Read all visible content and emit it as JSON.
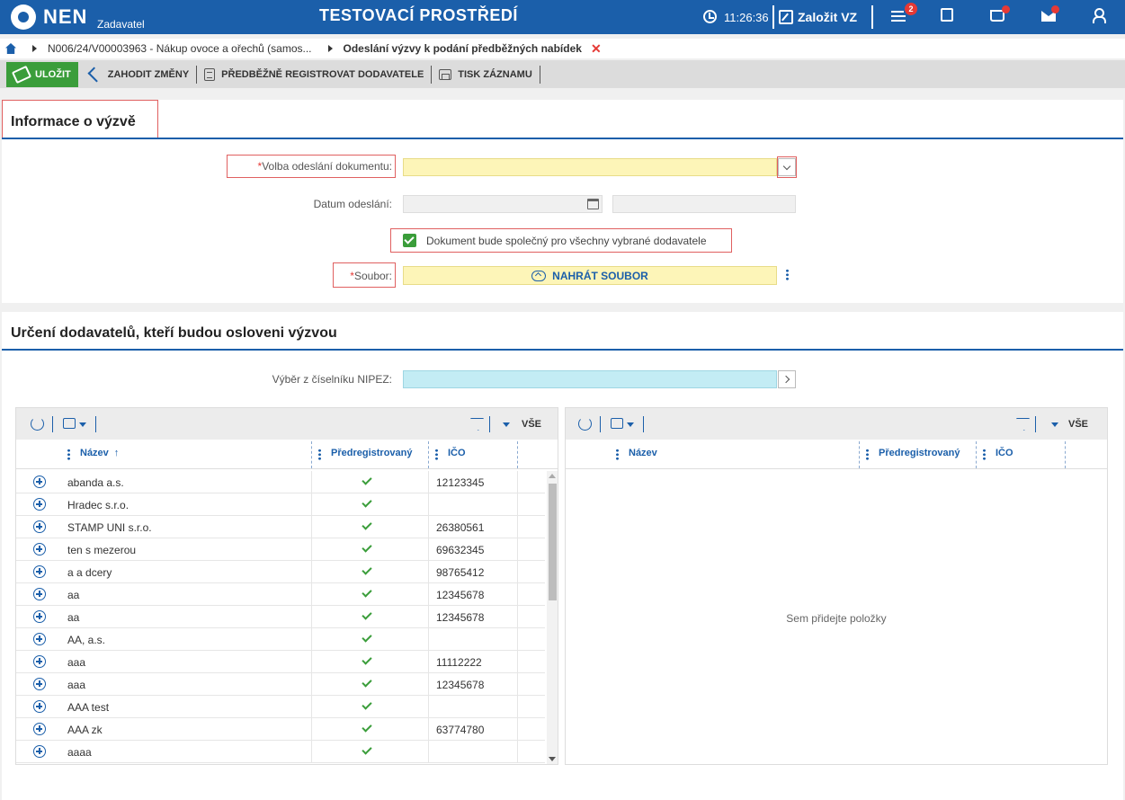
{
  "header": {
    "brand": "NEN",
    "brand_sub": "Zadavatel",
    "environment": "TESTOVACÍ PROSTŘEDÍ",
    "time": "11:26:36",
    "new_vz_label": "Založit VZ",
    "notification_count": "2",
    "color": "#1b5faa"
  },
  "breadcrumb": {
    "item1": "N006/24/V00003963 - Nákup ovoce a ořechů (samos...",
    "item2": "Odeslání výzvy k podání předběžných nabídek",
    "close": "✕"
  },
  "toolbar": {
    "save": "ULOŽIT",
    "discard": "ZAHODIT ZMĚNY",
    "preregister": "PŘEDBĚŽNĚ REGISTROVAT DODAVATELE",
    "print": "TISK ZÁZNAMU"
  },
  "info_section": {
    "title": "Informace o výzvě",
    "send_option_label": "Volba odeslání dokumentu:",
    "send_option_value": "",
    "send_date_label": "Datum odeslání:",
    "common_doc_label": "Dokument bude společný pro všechny vybrané dodavatele",
    "common_doc_checked": true,
    "file_label": "Soubor:",
    "upload_label": "NAHRÁT SOUBOR",
    "required_marker": "*"
  },
  "suppliers_section": {
    "title": "Určení dodavatelů, kteří budou osloveni výzvou",
    "nipez_label": "Výběr z číselníku NIPEZ:"
  },
  "left_grid": {
    "all_label": "VŠE",
    "columns": [
      "Název",
      "Předregistrovaný",
      "IČO"
    ],
    "sort_indicator": "↑",
    "rows": [
      {
        "name": "abanda a.s.",
        "prereg": true,
        "ico": "12123345"
      },
      {
        "name": "Hradec s.r.o.",
        "prereg": true,
        "ico": ""
      },
      {
        "name": "STAMP UNI s.r.o.",
        "prereg": true,
        "ico": "26380561"
      },
      {
        "name": "ten s mezerou",
        "prereg": true,
        "ico": "69632345"
      },
      {
        "name": "a a dcery",
        "prereg": true,
        "ico": "98765412"
      },
      {
        "name": "aa",
        "prereg": true,
        "ico": "12345678"
      },
      {
        "name": "aa",
        "prereg": true,
        "ico": "12345678"
      },
      {
        "name": "AA, a.s.",
        "prereg": true,
        "ico": ""
      },
      {
        "name": "aaa",
        "prereg": true,
        "ico": "11112222"
      },
      {
        "name": "aaa",
        "prereg": true,
        "ico": "12345678"
      },
      {
        "name": "AAA test",
        "prereg": true,
        "ico": ""
      },
      {
        "name": "AAA zk",
        "prereg": true,
        "ico": "63774780"
      },
      {
        "name": "aaaa",
        "prereg": true,
        "ico": ""
      }
    ]
  },
  "right_grid": {
    "all_label": "VŠE",
    "columns": [
      "Název",
      "Předregistrovaný",
      "IČO"
    ],
    "empty_message": "Sem přidejte položky"
  }
}
